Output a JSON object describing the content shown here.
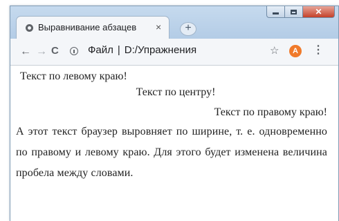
{
  "tab": {
    "title": "Выравнивание абзацев",
    "favicon_icon": "globe-icon",
    "close_glyph": "×",
    "new_tab_glyph": "+"
  },
  "window_controls": {
    "minimize_icon": "minimize-icon",
    "maximize_icon": "maximize-icon",
    "close_icon": "close-icon",
    "close_color": "#c4412a"
  },
  "toolbar": {
    "back_glyph": "←",
    "forward_glyph": "→",
    "reload_glyph": "C",
    "address_label": "Файл",
    "address_separator": "|",
    "address_path": "D:/Упражнения",
    "star_glyph": "☆",
    "avatar_letter": "A",
    "avatar_color": "#f07a2b",
    "menu_glyph": "⋮"
  },
  "content": {
    "left": "Текст по левому краю!",
    "center": "Текст по центру!",
    "right": "Текст по правому краю!",
    "justify": "А этот текст браузер выровняет по ширине, т. е. одновременно по правому и левому краю. Для этого будет изменена величина пробела между словами."
  }
}
